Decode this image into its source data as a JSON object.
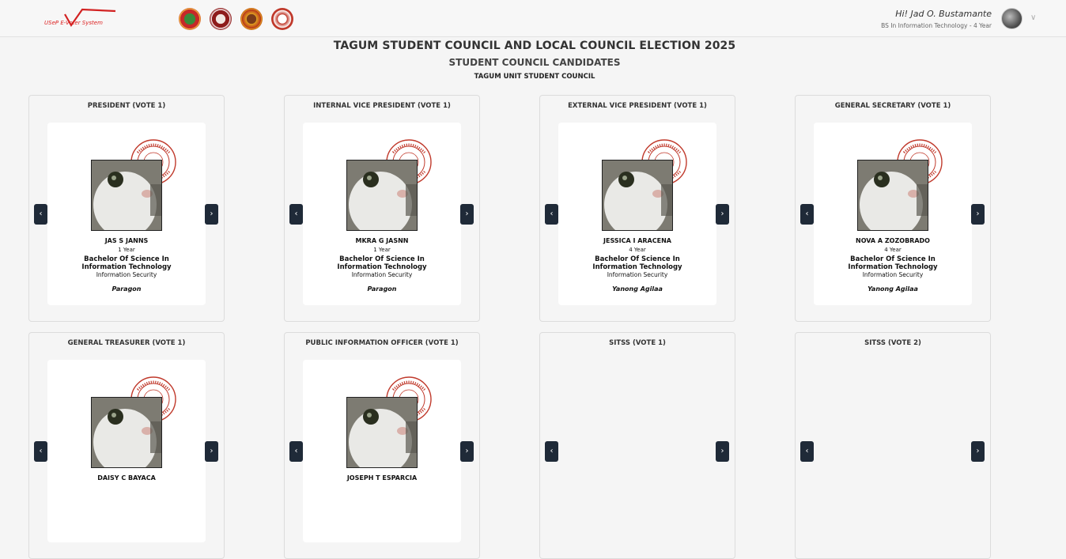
{
  "header": {
    "brand": "USeP E-Voter System",
    "user_name": "Hi! Jad O. Bustamante",
    "user_program": "BS In Information Technology - 4 Year"
  },
  "titles": {
    "election": "TAGUM STUDENT COUNCIL AND LOCAL COUNCIL ELECTION 2025",
    "section": "STUDENT COUNCIL CANDIDATES",
    "unit": "TAGUM UNIT STUDENT COUNCIL"
  },
  "positions": [
    {
      "title": "PRESIDENT (VOTE 1)",
      "candidate": {
        "name": "JAS S JANNS",
        "year": "1 Year",
        "program": "Bachelor Of Science In Information Technology",
        "major": "Information Security",
        "party": "Paragon"
      }
    },
    {
      "title": "INTERNAL VICE PRESIDENT (VOTE 1)",
      "candidate": {
        "name": "MKRA G JASNN",
        "year": "1 Year",
        "program": "Bachelor Of Science In Information Technology",
        "major": "Information Security",
        "party": "Paragon"
      }
    },
    {
      "title": "EXTERNAL VICE PRESIDENT (VOTE 1)",
      "candidate": {
        "name": "JESSICA I ARACENA",
        "year": "4 Year",
        "program": "Bachelor Of Science In Information Technology",
        "major": "Information Security",
        "party": "Yanong Agilaa"
      }
    },
    {
      "title": "GENERAL SECRETARY (VOTE 1)",
      "candidate": {
        "name": "NOVA A ZOZOBRADO",
        "year": "4 Year",
        "program": "Bachelor Of Science In Information Technology",
        "major": "Information Security",
        "party": "Yanong Agilaa"
      }
    },
    {
      "title": "GENERAL TREASURER (VOTE 1)",
      "candidate": {
        "name": "DAISY C BAYACA"
      }
    },
    {
      "title": "PUBLIC INFORMATION OFFICER (VOTE 1)",
      "candidate": {
        "name": "JOSEPH T ESPARCIA"
      }
    },
    {
      "title": "SITSS (VOTE 1)"
    },
    {
      "title": "SITSS (VOTE 2)"
    }
  ],
  "nav": {
    "prev": "‹",
    "next": "›"
  },
  "colors": {
    "brand_red": "#d22222",
    "nav_dark": "#1f2a38",
    "seal_red": "#c0392b"
  }
}
